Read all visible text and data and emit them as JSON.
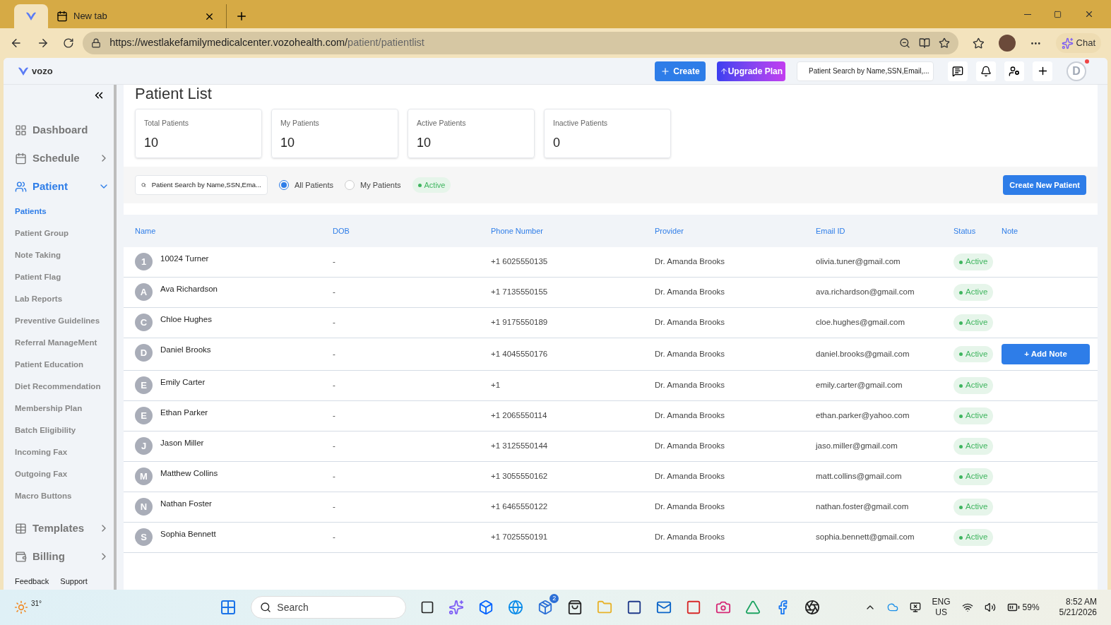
{
  "browser": {
    "tabs": [
      {
        "kind": "app",
        "selected": true
      },
      {
        "label": "New tab",
        "kind": "page",
        "selected": false
      }
    ],
    "url_host": "https://westlakefamilymedicalcenter.vozohealth.com/",
    "url_path": "patient/patientlist",
    "chat": "Chat"
  },
  "header": {
    "logo": "vozo",
    "create": "Create",
    "upgrade": "Upgrade Plan",
    "search_placeholder": "Patient Search by Name,SSN,Email,...",
    "avatar": "D",
    "notification_dot": true
  },
  "sidebar": {
    "items": [
      {
        "label": "Dashboard",
        "kind": "link",
        "selected": false
      },
      {
        "label": "Schedule",
        "kind": "collapsed",
        "selected": false
      },
      {
        "label": "Patient",
        "kind": "expanded",
        "selected": true,
        "children": [
          {
            "label": "Patients",
            "selected": true
          },
          {
            "label": "Patient Group",
            "selected": false
          },
          {
            "label": "Note Taking",
            "selected": false
          },
          {
            "label": "Patient Flag",
            "selected": false
          },
          {
            "label": "Lab Reports",
            "selected": false
          },
          {
            "label": "Preventive Guidelines",
            "selected": false
          },
          {
            "label": "Referral ManageMent",
            "selected": false
          },
          {
            "label": "Patient Education",
            "selected": false
          },
          {
            "label": "Diet Recommendation",
            "selected": false
          },
          {
            "label": "Membership Plan",
            "selected": false
          },
          {
            "label": "Batch Eligibility",
            "selected": false
          },
          {
            "label": "Incoming Fax",
            "selected": false
          },
          {
            "label": "Outgoing Fax",
            "selected": false
          },
          {
            "label": "Macro Buttons",
            "selected": false
          }
        ]
      },
      {
        "label": "Templates",
        "kind": "collapsed",
        "selected": false
      },
      {
        "label": "Billing",
        "kind": "collapsed",
        "selected": false
      }
    ],
    "footer_links": [
      "Feedback",
      "Support"
    ]
  },
  "page_title": "Patient List",
  "stats": [
    {
      "label": "Total Patients",
      "value": "10"
    },
    {
      "label": "My Patients",
      "value": "10"
    },
    {
      "label": "Active Patients",
      "value": "10"
    },
    {
      "label": "Inactive Patients",
      "value": "0"
    }
  ],
  "filters": {
    "search_placeholder": "Patient Search by Name,SSN,Ema...",
    "radios": [
      {
        "label": "All Patients",
        "selected": true
      },
      {
        "label": "My Patients",
        "selected": false
      }
    ],
    "status_chip": "Active",
    "create_button": "Create New Patient"
  },
  "table": {
    "columns": [
      "Name",
      "DOB",
      "Phone Number",
      "Provider",
      "Email ID",
      "Status",
      "Note"
    ],
    "rows": [
      {
        "initial": "1",
        "name": "10024 Turner",
        "dob": "-",
        "phone": "+1 6025550135",
        "provider": "Dr. Amanda Brooks",
        "email": "olivia.tuner@gmail.com",
        "status": "Active"
      },
      {
        "initial": "A",
        "name": "Ava Richardson",
        "dob": "-",
        "phone": "+1 7135550155",
        "provider": "Dr. Amanda Brooks",
        "email": "ava.richardson@gmail.com",
        "status": "Active"
      },
      {
        "initial": "C",
        "name": "Chloe Hughes",
        "dob": "-",
        "phone": "+1 9175550189",
        "provider": "Dr. Amanda Brooks",
        "email": "cloe.hughes@gmail.com",
        "status": "Active"
      },
      {
        "initial": "D",
        "name": "Daniel Brooks",
        "dob": "-",
        "phone": "+1 4045550176",
        "provider": "Dr. Amanda Brooks",
        "email": "daniel.brooks@gmail.com",
        "status": "Active",
        "note_button": "+ Add Note"
      },
      {
        "initial": "E",
        "name": "Emily Carter",
        "dob": "-",
        "phone": "+1",
        "provider": "Dr. Amanda Brooks",
        "email": "emily.carter@gmail.com",
        "status": "Active"
      },
      {
        "initial": "E",
        "name": "Ethan Parker",
        "dob": "-",
        "phone": "+1 2065550114",
        "provider": "Dr. Amanda Brooks",
        "email": "ethan.parker@yahoo.com",
        "status": "Active"
      },
      {
        "initial": "J",
        "name": "Jason Miller",
        "dob": "-",
        "phone": "+1 3125550144",
        "provider": "Dr. Amanda Brooks",
        "email": "jaso.miller@gmail.com",
        "status": "Active"
      },
      {
        "initial": "M",
        "name": "Matthew Collins",
        "dob": "-",
        "phone": "+1 3055550162",
        "provider": "Dr. Amanda Brooks",
        "email": "matt.collins@gmail.com",
        "status": "Active"
      },
      {
        "initial": "N",
        "name": "Nathan Foster",
        "dob": "-",
        "phone": "+1 6465550122",
        "provider": "Dr. Amanda Brooks",
        "email": "nathan.foster@gmail.com",
        "status": "Active"
      },
      {
        "initial": "S",
        "name": "Sophia Bennett",
        "dob": "-",
        "phone": "+1 7025550191",
        "provider": "Dr. Amanda Brooks",
        "email": "sophia.bennett@gmail.com",
        "status": "Active"
      }
    ]
  },
  "taskbar": {
    "weather": "31°",
    "search": "Search",
    "store_badge": "2",
    "language": "ENG",
    "region": "US",
    "battery": "59%",
    "time": "8:52 AM",
    "date": "5/21/2026"
  }
}
